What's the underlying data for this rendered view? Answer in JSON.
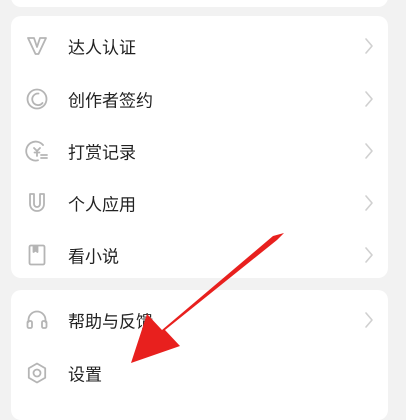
{
  "menu_group_1": {
    "items": [
      {
        "label": "达人认证",
        "icon": "v-badge-icon"
      },
      {
        "label": "创作者签约",
        "icon": "moon-circle-icon"
      },
      {
        "label": "打赏记录",
        "icon": "coin-list-icon"
      },
      {
        "label": "个人应用",
        "icon": "magnet-icon"
      },
      {
        "label": "看小说",
        "icon": "book-icon"
      }
    ]
  },
  "menu_group_2": {
    "items": [
      {
        "label": "帮助与反馈",
        "icon": "headset-icon"
      },
      {
        "label": "设置",
        "icon": "gear-icon"
      }
    ]
  },
  "colors": {
    "background": "#f2f2f2",
    "card": "#ffffff",
    "text": "#222222",
    "icon": "#b5b5b5",
    "chevron": "#d0d0d0",
    "annotation_arrow": "#e8201e"
  }
}
